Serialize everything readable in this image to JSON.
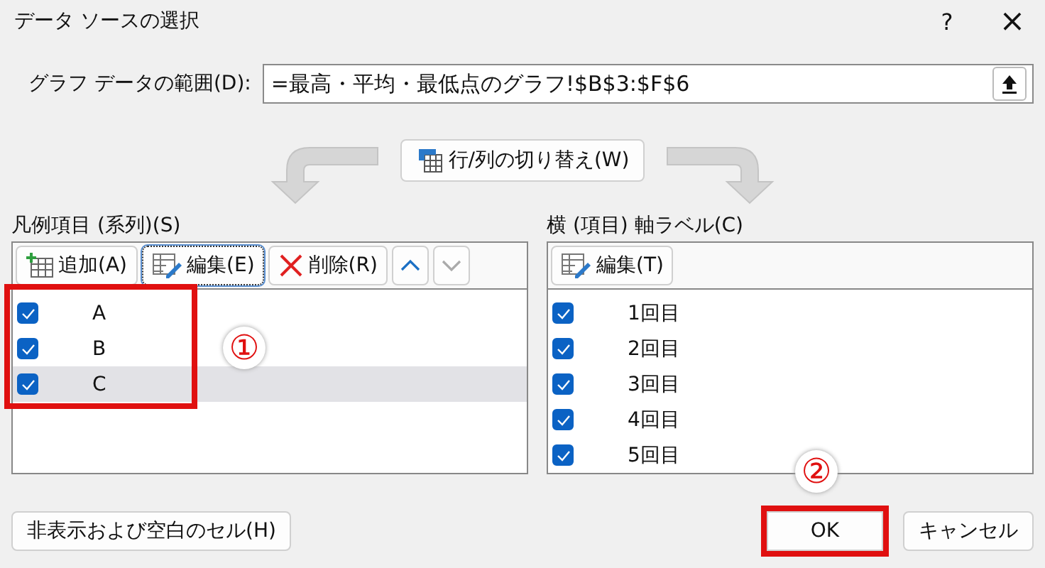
{
  "window": {
    "title": "データ ソースの選択",
    "help": "?",
    "close": "×"
  },
  "range": {
    "label": "グラフ データの範囲(D):",
    "value": "=最高・平均・最低点のグラフ!$B$3:$F$6"
  },
  "swap_button": "行/列の切り替え(W)",
  "series_panel": {
    "label": "凡例項目 (系列)(S)",
    "add": "追加(A)",
    "edit": "編集(E)",
    "remove": "削除(R)",
    "items": [
      {
        "label": "A",
        "checked": true,
        "selected": false
      },
      {
        "label": "B",
        "checked": true,
        "selected": false
      },
      {
        "label": "C",
        "checked": true,
        "selected": true
      }
    ],
    "callout": "①"
  },
  "axis_panel": {
    "label": "横 (項目) 軸ラベル(C)",
    "edit": "編集(T)",
    "items": [
      {
        "label": "1回目",
        "checked": true,
        "selected": false
      },
      {
        "label": "2回目",
        "checked": true,
        "selected": false
      },
      {
        "label": "3回目",
        "checked": true,
        "selected": false
      },
      {
        "label": "4回目",
        "checked": true,
        "selected": false
      },
      {
        "label": "5回目",
        "checked": true,
        "selected": false
      }
    ]
  },
  "hidden_cells_button": "非表示および空白のセル(H)",
  "ok_button": "OK",
  "ok_callout": "②",
  "cancel_button": "キャンセル"
}
